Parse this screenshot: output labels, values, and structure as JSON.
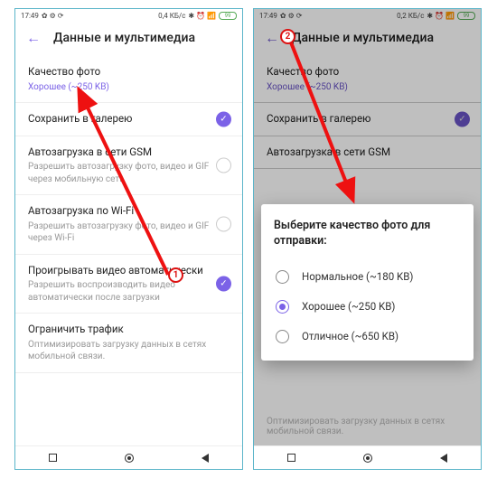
{
  "status": {
    "time": "17:49",
    "net_left": "0,4 КБ/с",
    "net_right": "0,2 КБ/с",
    "batt": "99"
  },
  "header": {
    "title": "Данные и мультимедиа"
  },
  "rows": {
    "quality": {
      "title": "Качество фото",
      "sub": "Хорошее (~250 KB)"
    },
    "gallery": {
      "title": "Сохранить в галерею"
    },
    "gsm": {
      "title": "Автозагрузка в сети GSM",
      "sub": "Разрешить автозагрузку фото, видео и GIF через мобильную сеть"
    },
    "wifi": {
      "title": "Автозагрузка по Wi-Fi",
      "sub": "Разрешить автозагрузку фото, видео и GIF через Wi-Fi"
    },
    "autoplay": {
      "title": "Проигрывать видео автоматически",
      "sub": "Разрешить воспроизводить видео автоматически после загрузки"
    },
    "traffic": {
      "title": "Ограничить трафик",
      "sub": "Оптимизировать загрузку данных в сетях мобильной связи."
    }
  },
  "dialog": {
    "title": "Выберите качество фото для отправки:",
    "opts": [
      {
        "label": "Нормальное (~180 KB)"
      },
      {
        "label": "Хорошее (~250 KB)"
      },
      {
        "label": "Отличное (~650 KB)"
      }
    ]
  },
  "marks": {
    "one": "1",
    "two": "2"
  }
}
